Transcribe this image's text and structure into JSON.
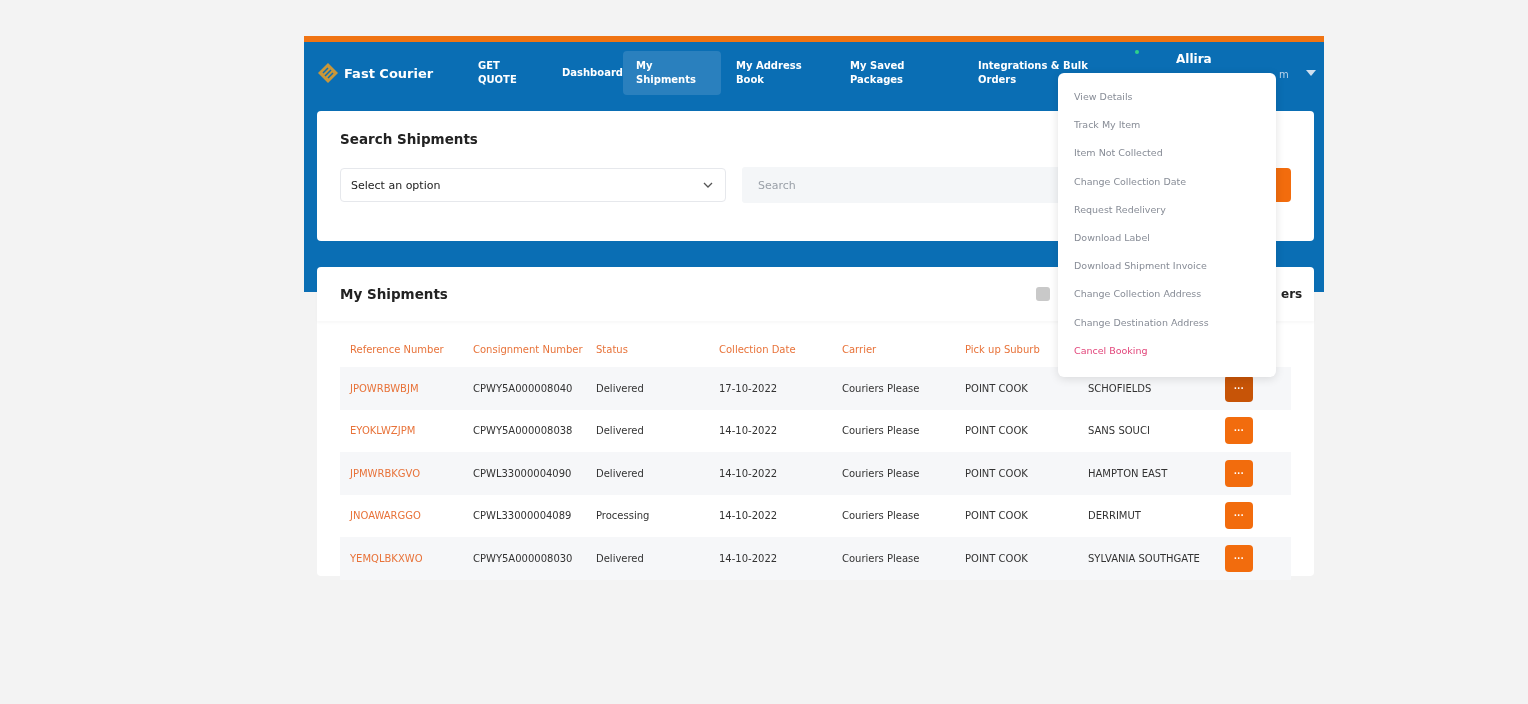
{
  "brand": {
    "name": "Fast Courier"
  },
  "nav": [
    {
      "label": "GET QUOTE",
      "selected": false
    },
    {
      "label": "Dashboard",
      "selected": false
    },
    {
      "label": "My Shipments",
      "selected": true
    },
    {
      "label": "My Address Book",
      "selected": false
    },
    {
      "label": "My Saved Packages",
      "selected": false
    },
    {
      "label": "Integrations & Bulk Orders",
      "selected": false
    }
  ],
  "user": {
    "name": "Allira",
    "subtitle": "m",
    "online": true
  },
  "search_card": {
    "title": "Search Shipments",
    "select": {
      "value": "Select an option"
    },
    "search": {
      "placeholder": "Search"
    }
  },
  "shipments": {
    "title": "My Shipments",
    "checkbox": {
      "checked": false
    },
    "right_text": "ers",
    "columns": [
      "Reference Number",
      "Consignment Number",
      "Status",
      "Collection Date",
      "Carrier",
      "Pick up Suburb"
    ],
    "rows": [
      {
        "cells": [
          "JPOWRBWBJM",
          "CPWY5A000008040",
          "Delivered",
          "17-10-2022",
          "Couriers Please",
          "POINT COOK",
          "SCHOFIELDS"
        ],
        "selected": true
      },
      {
        "cells": [
          "EYOKLWZJPM",
          "CPWY5A000008038",
          "Delivered",
          "14-10-2022",
          "Couriers Please",
          "POINT COOK",
          "SANS SOUCI"
        ],
        "selected": false
      },
      {
        "cells": [
          "JPMWRBKGVO",
          "CPWL33000004090",
          "Delivered",
          "14-10-2022",
          "Couriers Please",
          "POINT COOK",
          "HAMPTON EAST"
        ],
        "selected": false
      },
      {
        "cells": [
          "JNOAWARGGO",
          "CPWL33000004089",
          "Processing",
          "14-10-2022",
          "Couriers Please",
          "POINT COOK",
          "DERRIMUT"
        ],
        "selected": false
      },
      {
        "cells": [
          "YEMQLBKXWO",
          "CPWY5A000008030",
          "Delivered",
          "14-10-2022",
          "Couriers Please",
          "POINT COOK",
          "SYLVANIA SOUTHGATE"
        ],
        "selected": false
      }
    ],
    "action_label": "···"
  },
  "menu": {
    "items": [
      {
        "label": "View Details",
        "kind": "normal"
      },
      {
        "label": "Track My Item",
        "kind": "normal"
      },
      {
        "label": "Item Not Collected",
        "kind": "normal"
      },
      {
        "label": "Change Collection Date",
        "kind": "normal"
      },
      {
        "label": "Request Redelivery",
        "kind": "normal"
      },
      {
        "label": "Download Label",
        "kind": "normal"
      },
      {
        "label": "Download Shipment Invoice",
        "kind": "normal"
      },
      {
        "label": "Change Collection Address",
        "kind": "normal"
      },
      {
        "label": "Change Destination Address",
        "kind": "normal"
      },
      {
        "label": "Cancel Booking",
        "kind": "danger"
      }
    ]
  }
}
